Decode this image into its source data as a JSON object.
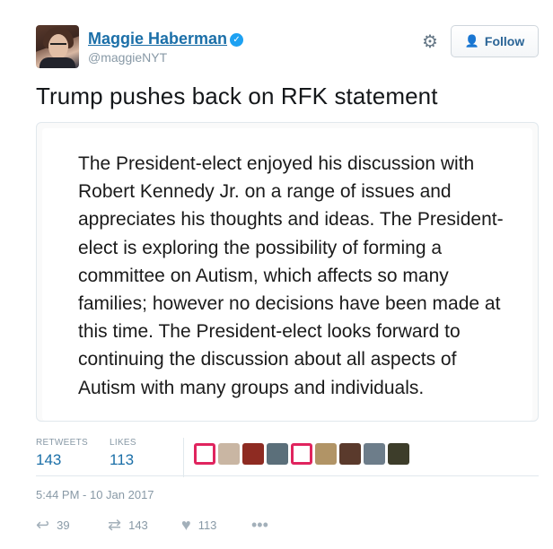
{
  "author": {
    "display_name": "Maggie Haberman",
    "handle": "@maggieNYT",
    "verified_icon": "check"
  },
  "follow_button": {
    "label": "Follow",
    "icon": "add-person-icon"
  },
  "settings_icon": "gear-icon",
  "tweet": {
    "text": "Trump pushes back on RFK statement",
    "statement": "The President-elect enjoyed his discussion with Robert Kennedy Jr. on a range of issues and appreciates his thoughts and ideas. The President-elect is exploring the possibility of forming a committee on Autism, which affects so many families; however no decisions have been made at this time. The President-elect looks forward to continuing the discussion about all aspects of Autism with many groups and individuals."
  },
  "stats": {
    "retweets_label": "RETWEETS",
    "retweets_value": "143",
    "likes_label": "LIKES",
    "likes_value": "113"
  },
  "likers": [
    {
      "color": "#e0245e"
    },
    {
      "color": "#c9b6a3"
    },
    {
      "color": "#8e2b22"
    },
    {
      "color": "#5b6f7a"
    },
    {
      "color": "#e0245e"
    },
    {
      "color": "#b19466"
    },
    {
      "color": "#5a3a2c"
    },
    {
      "color": "#6d7d8a"
    },
    {
      "color": "#3d3d2a"
    }
  ],
  "timestamp": "5:44 PM - 10 Jan 2017",
  "actions": {
    "reply_count": "39",
    "retweet_count": "143",
    "like_count": "113",
    "more_icon": "•••"
  }
}
